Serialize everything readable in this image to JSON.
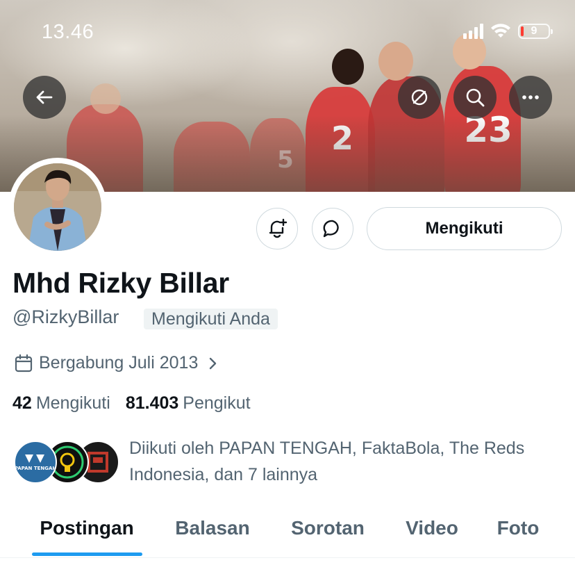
{
  "status_bar": {
    "time": "13.46",
    "battery": "9"
  },
  "banner": {
    "jersey_numbers": [
      "2",
      "23",
      "5"
    ]
  },
  "header_actions": {
    "back_icon": "arrow-left-icon",
    "translate_icon": "no-translation-icon",
    "search_icon": "search-icon",
    "more_icon": "more-icon"
  },
  "profile": {
    "name": "Mhd Rizky Billar",
    "handle": "@RizkyBillar",
    "follows_you_badge": "Mengikuti Anda",
    "joined": "Bergabung Juli 2013",
    "following_count": "42",
    "following_label": "Mengikuti",
    "followers_count": "81.403",
    "followers_label": "Pengikut",
    "followed_by_text": "Diikuti oleh PAPAN TENGAH, FaktaBola, The Reds Indonesia, dan 7 lainnya",
    "followed_by_avatars": [
      {
        "name": "PAPAN TENGAH",
        "label": "PAPAN TENGAH",
        "color": "#2b6ca3"
      },
      {
        "name": "FaktaBola",
        "label": "",
        "color": "#101010"
      },
      {
        "name": "The Reds Indonesia",
        "label": "",
        "color": "#1a1a1a"
      }
    ]
  },
  "actions": {
    "notify_icon": "bell-plus-icon",
    "message_icon": "message-icon",
    "follow_button": "Mengikuti"
  },
  "tabs": [
    {
      "label": "Postingan",
      "active": true
    },
    {
      "label": "Balasan",
      "active": false
    },
    {
      "label": "Sorotan",
      "active": false
    },
    {
      "label": "Video",
      "active": false
    },
    {
      "label": "Foto",
      "active": false
    }
  ],
  "colors": {
    "accent": "#1d9bf0",
    "text_primary": "#0f1419",
    "text_secondary": "#536471",
    "border": "#cfd9de",
    "jersey_red": "#d83a3a"
  }
}
